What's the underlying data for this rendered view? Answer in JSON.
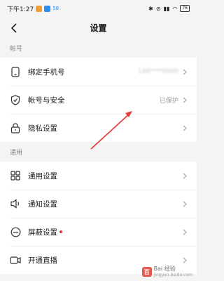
{
  "status_bar": {
    "time": "下午1:27",
    "app_badge": "58",
    "battery": "76"
  },
  "header": {
    "title": "设置"
  },
  "sections": {
    "account": "帐号",
    "general": "通用"
  },
  "account_items": [
    {
      "label": "绑定手机号",
      "value": "188****0000"
    },
    {
      "label": "帐号与安全",
      "value": "已保护"
    },
    {
      "label": "隐私设置",
      "value": ""
    }
  ],
  "general_items": [
    {
      "label": "通用设置"
    },
    {
      "label": "通知设置"
    },
    {
      "label": "屏蔽设置"
    },
    {
      "label": "开通直播"
    }
  ],
  "watermark": {
    "badge": "百",
    "line1": "Bai 经验",
    "line2": "jingyan.baidu.com"
  },
  "colors": {
    "annotation_arrow": "#e53935",
    "red_dot": "#e53935"
  }
}
